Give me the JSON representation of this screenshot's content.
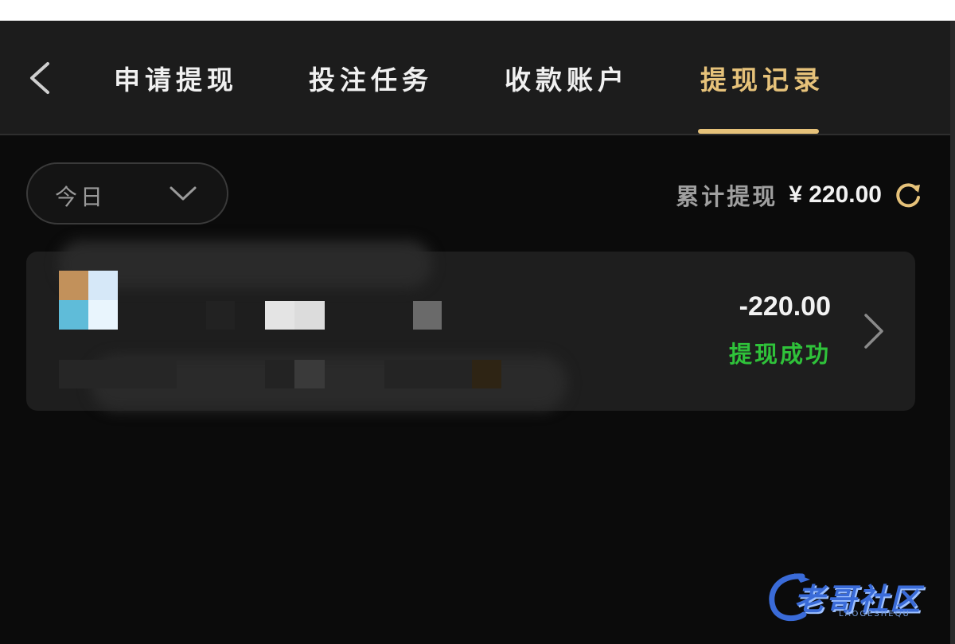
{
  "header": {
    "tabs": [
      {
        "label": "申请提现",
        "active": false
      },
      {
        "label": "投注任务",
        "active": false
      },
      {
        "label": "收款账户",
        "active": false
      },
      {
        "label": "提现记录",
        "active": true
      }
    ],
    "back_icon": "chevron-left-icon"
  },
  "filter": {
    "selected": "今日",
    "icon": "chevron-down-icon"
  },
  "summary": {
    "label": "累计提现",
    "value": "¥ 220.00",
    "icon": "refresh-icon"
  },
  "records": [
    {
      "amount": "-220.00",
      "status": "提现成功",
      "status_color": "#2fc23a"
    }
  ],
  "watermark": {
    "text": "老哥社区",
    "sub": "LAOGESHEQU"
  },
  "colors": {
    "accent": "#e6c27a",
    "background": "#0b0b0b",
    "header": "#1c1c1c",
    "success": "#2fc23a"
  }
}
